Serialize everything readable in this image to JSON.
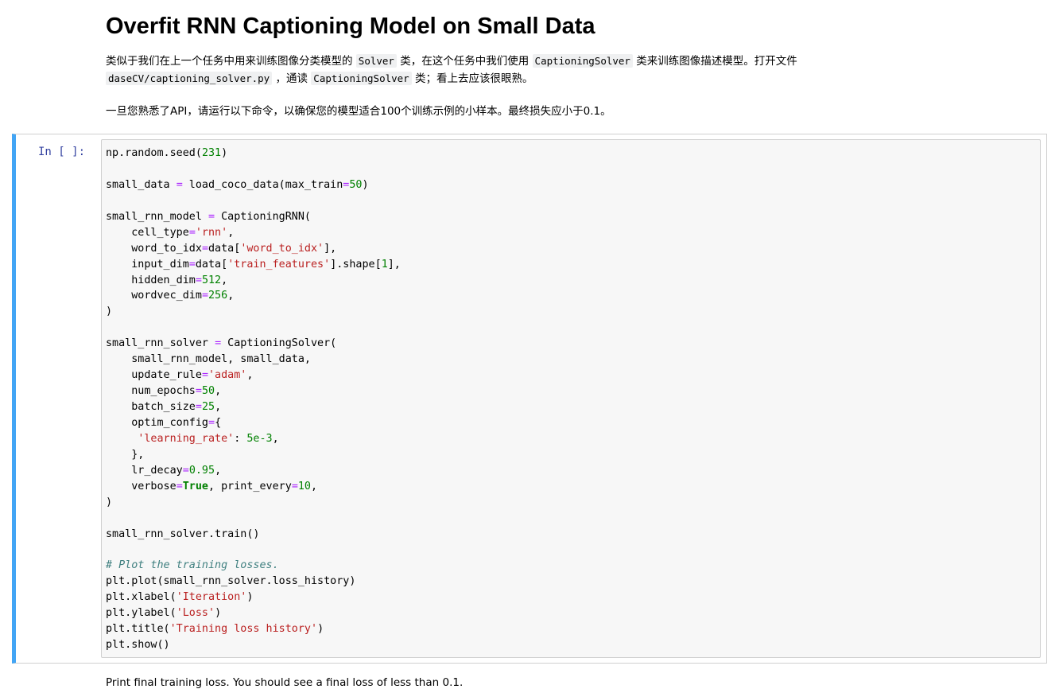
{
  "markdown": {
    "heading": "Overfit RNN Captioning Model on Small Data",
    "para1": {
      "t1": "类似于我们在上一个任务中用来训练图像分类模型的 ",
      "c1": "Solver",
      "t2": " 类，在这个任务中我们使用 ",
      "c2": "CaptioningSolver",
      "t3": " 类来训练图像描述模型。打开文件",
      "c3": "daseCV/captioning_solver.py",
      "t4": " ，通读 ",
      "c4": "CaptioningSolver",
      "t5": " 类；看上去应该很眼熟。"
    },
    "para2": "一旦您熟悉了API，请运行以下命令，以确保您的模型适合100个训练示例的小样本。最终损失应小于0.1。"
  },
  "cell": {
    "prompt": "In [ ]:",
    "lines": [
      [
        [
          "",
          "np.random.seed("
        ],
        [
          "num",
          "231"
        ],
        [
          "",
          ")"
        ]
      ],
      [],
      [
        [
          "",
          "small_data "
        ],
        [
          "op",
          "="
        ],
        [
          "",
          " load_coco_data(max_train"
        ],
        [
          "op",
          "="
        ],
        [
          "num",
          "50"
        ],
        [
          "",
          ")"
        ]
      ],
      [],
      [
        [
          "",
          "small_rnn_model "
        ],
        [
          "op",
          "="
        ],
        [
          "",
          " CaptioningRNN("
        ]
      ],
      [
        [
          "",
          "    cell_type"
        ],
        [
          "op",
          "="
        ],
        [
          "str",
          "'rnn'"
        ],
        [
          "",
          ","
        ]
      ],
      [
        [
          "",
          "    word_to_idx"
        ],
        [
          "op",
          "="
        ],
        [
          "",
          "data["
        ],
        [
          "str",
          "'word_to_idx'"
        ],
        [
          "",
          "],"
        ]
      ],
      [
        [
          "",
          "    input_dim"
        ],
        [
          "op",
          "="
        ],
        [
          "",
          "data["
        ],
        [
          "str",
          "'train_features'"
        ],
        [
          "",
          "].shape["
        ],
        [
          "num",
          "1"
        ],
        [
          "",
          "],"
        ]
      ],
      [
        [
          "",
          "    hidden_dim"
        ],
        [
          "op",
          "="
        ],
        [
          "num",
          "512"
        ],
        [
          "",
          ","
        ]
      ],
      [
        [
          "",
          "    wordvec_dim"
        ],
        [
          "op",
          "="
        ],
        [
          "num",
          "256"
        ],
        [
          "",
          ","
        ]
      ],
      [
        [
          "",
          ")"
        ]
      ],
      [],
      [
        [
          "",
          "small_rnn_solver "
        ],
        [
          "op",
          "="
        ],
        [
          "",
          " CaptioningSolver("
        ]
      ],
      [
        [
          "",
          "    small_rnn_model, small_data,"
        ]
      ],
      [
        [
          "",
          "    update_rule"
        ],
        [
          "op",
          "="
        ],
        [
          "str",
          "'adam'"
        ],
        [
          "",
          ","
        ]
      ],
      [
        [
          "",
          "    num_epochs"
        ],
        [
          "op",
          "="
        ],
        [
          "num",
          "50"
        ],
        [
          "",
          ","
        ]
      ],
      [
        [
          "",
          "    batch_size"
        ],
        [
          "op",
          "="
        ],
        [
          "num",
          "25"
        ],
        [
          "",
          ","
        ]
      ],
      [
        [
          "",
          "    optim_config"
        ],
        [
          "op",
          "="
        ],
        [
          "",
          "{"
        ]
      ],
      [
        [
          "",
          "     "
        ],
        [
          "str",
          "'learning_rate'"
        ],
        [
          "",
          ": "
        ],
        [
          "num",
          "5e-3"
        ],
        [
          "",
          ","
        ]
      ],
      [
        [
          "",
          "    },"
        ]
      ],
      [
        [
          "",
          "    lr_decay"
        ],
        [
          "op",
          "="
        ],
        [
          "num",
          "0.95"
        ],
        [
          "",
          ","
        ]
      ],
      [
        [
          "",
          "    verbose"
        ],
        [
          "op",
          "="
        ],
        [
          "kw",
          "True"
        ],
        [
          "",
          ", print_every"
        ],
        [
          "op",
          "="
        ],
        [
          "num",
          "10"
        ],
        [
          "",
          ","
        ]
      ],
      [
        [
          "",
          ")"
        ]
      ],
      [],
      [
        [
          "",
          "small_rnn_solver.train()"
        ]
      ],
      [],
      [
        [
          "cm",
          "# Plot the training losses."
        ]
      ],
      [
        [
          "",
          "plt.plot(small_rnn_solver.loss_history)"
        ]
      ],
      [
        [
          "",
          "plt.xlabel("
        ],
        [
          "str",
          "'Iteration'"
        ],
        [
          "",
          ")"
        ]
      ],
      [
        [
          "",
          "plt.ylabel("
        ],
        [
          "str",
          "'Loss'"
        ],
        [
          "",
          ")"
        ]
      ],
      [
        [
          "",
          "plt.title("
        ],
        [
          "str",
          "'Training loss history'"
        ],
        [
          "",
          ")"
        ]
      ],
      [
        [
          "",
          "plt.show()"
        ]
      ]
    ]
  },
  "bottom_text": "Print final training loss. You should see a final loss of less than 0.1."
}
